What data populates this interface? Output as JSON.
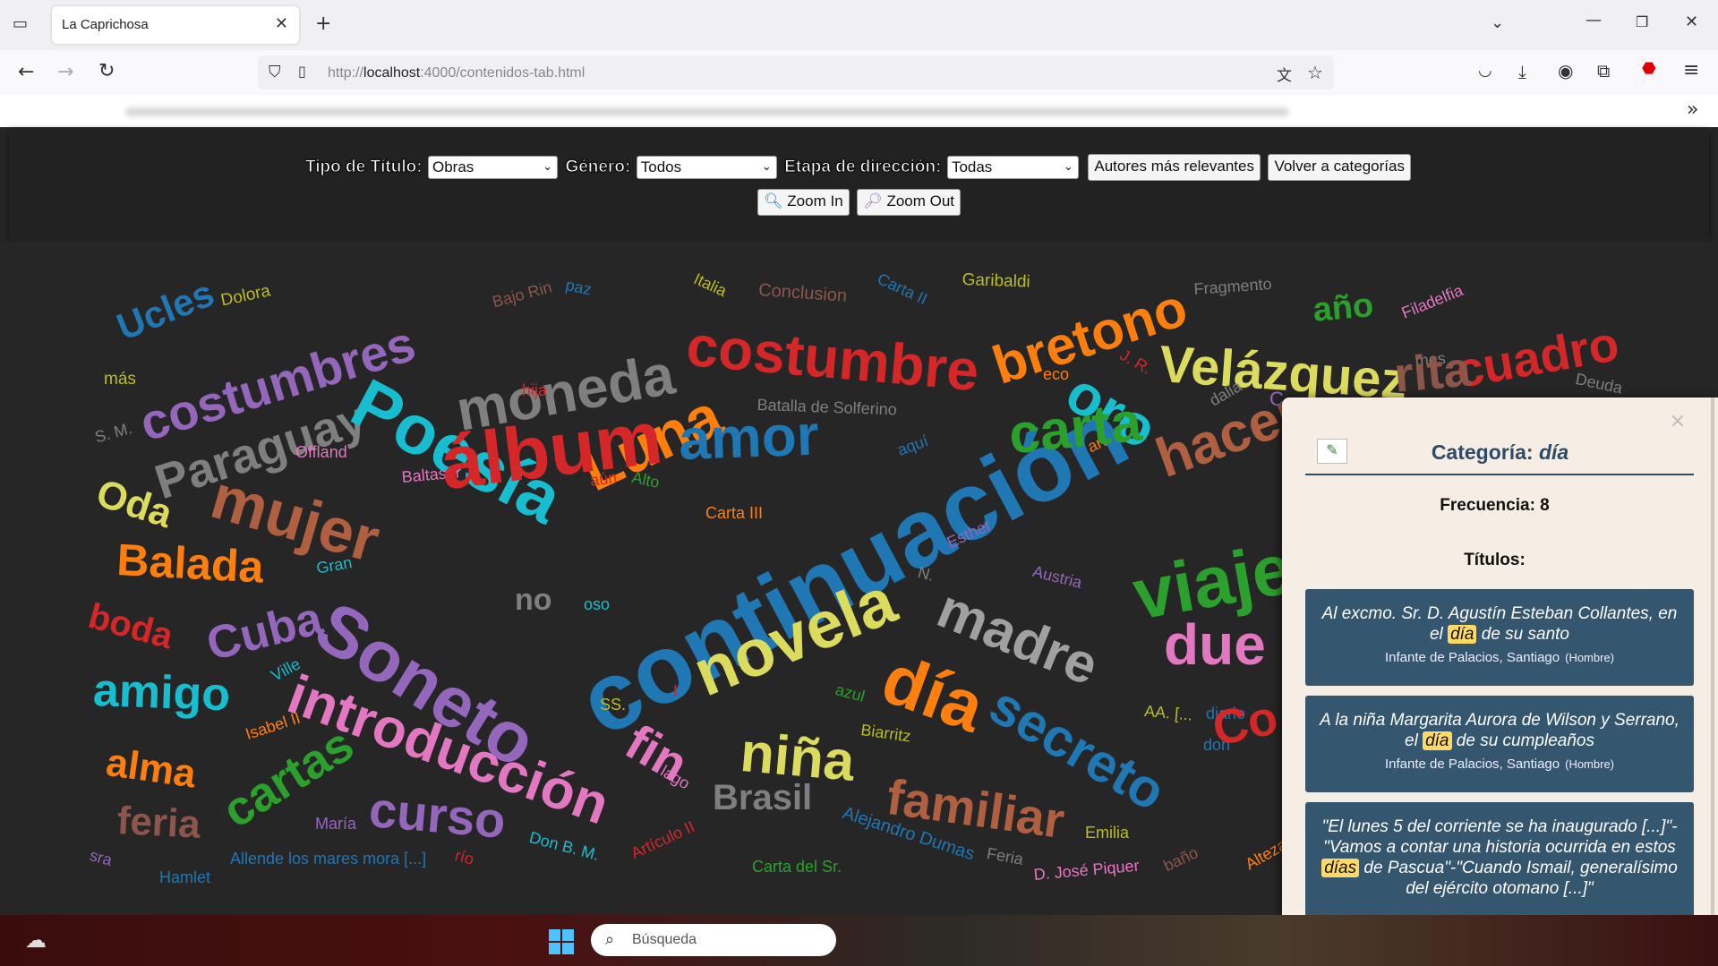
{
  "browser": {
    "tab_title": "La Caprichosa",
    "url_prefix": "http://",
    "url_host": "localhost",
    "url_rest": ":4000/contenidos-tab.html"
  },
  "controls": {
    "tipo_label": "Tipo de Título:",
    "tipo_value": "Obras",
    "genero_label": "Género:",
    "genero_value": "Todos",
    "etapa_label": "Etapa de dirección:",
    "etapa_value": "Todas",
    "autores_button": "Autores más relevantes",
    "volver_button": "Volver a categorías",
    "zoom_in": "Zoom In",
    "zoom_out": "Zoom Out"
  },
  "cloud_words": [
    {
      "t": "Ucles",
      "c": "#1f77b4"
    },
    {
      "t": "Dolora",
      "c": "#bcbd22"
    },
    {
      "t": "costumbres",
      "c": "#9467bd"
    },
    {
      "t": "Bajo Rin",
      "c": "#8c564b"
    },
    {
      "t": "paz",
      "c": "#1f77b4"
    },
    {
      "t": "moneda",
      "c": "#7f7f7f"
    },
    {
      "t": "Italia",
      "c": "#bcbd22"
    },
    {
      "t": "Conclusion",
      "c": "#8c564b"
    },
    {
      "t": "Carta II",
      "c": "#1f77b4"
    },
    {
      "t": "Garibaldi",
      "c": "#bcbd22"
    },
    {
      "t": "Fragmento",
      "c": "#7f7f7f"
    },
    {
      "t": "año",
      "c": "#2ca02c"
    },
    {
      "t": "Filadelfia",
      "c": "#e377c2"
    },
    {
      "t": "cuadro",
      "c": "#d62728"
    },
    {
      "t": "costumbre",
      "c": "#d62728"
    },
    {
      "t": "bretono",
      "c": "#ff7f0e"
    },
    {
      "t": "J. R.",
      "c": "#d62728"
    },
    {
      "t": "Velázquez",
      "c": "#dbdb5d"
    },
    {
      "t": "mes",
      "c": "#7f7f7f"
    },
    {
      "t": "más",
      "c": "#bcbd22"
    },
    {
      "t": "Paraguay",
      "c": "#7f7f7f"
    },
    {
      "t": "Poesía",
      "c": "#17becf"
    },
    {
      "t": "hija",
      "c": "#d62728"
    },
    {
      "t": "Luna",
      "c": "#ff7f0e"
    },
    {
      "t": "Batalla de Solferino",
      "c": "#7f7f7f"
    },
    {
      "t": "eco",
      "c": "#ff7f0e"
    },
    {
      "t": "oro",
      "c": "#17becf"
    },
    {
      "t": "dalia",
      "c": "#7f7f7f"
    },
    {
      "t": "rita",
      "c": "#8c564b"
    },
    {
      "t": "Deuda",
      "c": "#7f7f7f"
    },
    {
      "t": "S. M.",
      "c": "#7f7f7f"
    },
    {
      "t": "Offland",
      "c": "#e377c2"
    },
    {
      "t": "Baltasar",
      "c": "#e377c2"
    },
    {
      "t": "Alto",
      "c": "#2ca02c"
    },
    {
      "t": "aún",
      "c": "#d62728"
    },
    {
      "t": "amor",
      "c": "#1f77b4"
    },
    {
      "t": "aquí",
      "c": "#1f77b4"
    },
    {
      "t": "arte",
      "c": "#ff7f0e"
    },
    {
      "t": "hacer",
      "c": "#b06040"
    },
    {
      "t": "Oda",
      "c": "#dbdb5d"
    },
    {
      "t": "mujer",
      "c": "#b06040"
    },
    {
      "t": "Carta III",
      "c": "#ff7f0e"
    },
    {
      "t": "continuación",
      "c": "#1f77b4"
    },
    {
      "t": "carta",
      "c": "#2ca02c"
    },
    {
      "t": "álbum",
      "c": "#d62728"
    },
    {
      "t": "Balada",
      "c": "#ff7f0e"
    },
    {
      "t": "Gran",
      "c": "#17becf"
    },
    {
      "t": "Esther",
      "c": "#9467bd"
    },
    {
      "t": "Austria",
      "c": "#9467bd"
    },
    {
      "t": "viaje",
      "c": "#2ca02c"
    },
    {
      "t": "N.",
      "c": "#7f7f7f"
    },
    {
      "t": "no",
      "c": "#7f7f7f"
    },
    {
      "t": "oso",
      "c": "#17becf"
    },
    {
      "t": "boda",
      "c": "#d62728"
    },
    {
      "t": "Cuba",
      "c": "#9467bd"
    },
    {
      "t": "Soneto",
      "c": "#9467bd"
    },
    {
      "t": "novela",
      "c": "#dbdb5d"
    },
    {
      "t": "madre",
      "c": "#a0a0a0"
    },
    {
      "t": "due",
      "c": "#e377c2"
    },
    {
      "t": "Ville",
      "c": "#17becf"
    },
    {
      "t": "amigo",
      "c": "#17becf"
    },
    {
      "t": "introducción",
      "c": "#e377c2"
    },
    {
      "t": "día",
      "c": "#ff7f0e"
    },
    {
      "t": "I",
      "c": "#d62728"
    },
    {
      "t": "azul",
      "c": "#2ca02c"
    },
    {
      "t": "SS.",
      "c": "#bcbd22"
    },
    {
      "t": "AA. [...",
      "c": "#bcbd22"
    },
    {
      "t": "diario",
      "c": "#1f77b4"
    },
    {
      "t": "Isabel II",
      "c": "#ff7f0e"
    },
    {
      "t": "fin",
      "c": "#e377c2"
    },
    {
      "t": "Biarritz",
      "c": "#bcbd22"
    },
    {
      "t": "secreto",
      "c": "#1f77b4"
    },
    {
      "t": "alma",
      "c": "#ff7f0e"
    },
    {
      "t": "niña",
      "c": "#dbdb5d"
    },
    {
      "t": "don",
      "c": "#1f77b4"
    },
    {
      "t": "Co",
      "c": "#d62728"
    },
    {
      "t": "cartas",
      "c": "#2ca02c"
    },
    {
      "t": "curso",
      "c": "#9467bd"
    },
    {
      "t": "lago",
      "c": "#e377c2"
    },
    {
      "t": "familiar",
      "c": "#b06040"
    },
    {
      "t": "feria",
      "c": "#8c564b"
    },
    {
      "t": "María",
      "c": "#9467bd"
    },
    {
      "t": "Brasil",
      "c": "#7f7f7f"
    },
    {
      "t": "Alejandro Dumas",
      "c": "#1f77b4"
    },
    {
      "t": "Emilia",
      "c": "#bcbd22"
    },
    {
      "t": "Don B. M.",
      "c": "#17becf"
    },
    {
      "t": "Artículo II",
      "c": "#d62728"
    },
    {
      "t": "río",
      "c": "#d62728"
    },
    {
      "t": "Feria",
      "c": "#7f7f7f"
    },
    {
      "t": "baño",
      "c": "#8c564b"
    },
    {
      "t": "Alteza Re",
      "c": "#ff7f0e"
    },
    {
      "t": "sra",
      "c": "#9467bd"
    },
    {
      "t": "Hamlet",
      "c": "#1f77b4"
    },
    {
      "t": "Allende los mares mora [...]",
      "c": "#1f77b4"
    },
    {
      "t": "Carta del Sr.",
      "c": "#2ca02c"
    },
    {
      "t": "D. José Piquer",
      "c": "#e377c2"
    },
    {
      "t": "C",
      "c": "#9467bd"
    }
  ],
  "panel": {
    "title_prefix": "Categoría: ",
    "title_category": "día",
    "close": "×",
    "frecuencia": "Frecuencia: 8",
    "titulos_label": "Títulos:",
    "cards": [
      {
        "before": "Al excmo. Sr. D. Agustín Esteban Collantes, en el ",
        "hl": "día",
        "after": " de su santo",
        "author": "Infante de Palacios, Santiago",
        "gender": "(Hombre)"
      },
      {
        "before": "A la niña Margarita Aurora de Wilson y Serrano, el ",
        "hl": "día",
        "after": " de su cumpleaños",
        "author": "Infante de Palacios, Santiago",
        "gender": "(Hombre)"
      },
      {
        "before": "\"El lunes 5 del corriente se ha inaugurado [...]\"-\"Vamos a contar una historia ocurrida en estos ",
        "hl": "días",
        "after": " de Pascua\"-\"Cuando Ismail, generalísimo del ejército otomano [...]\"",
        "author": "",
        "gender": ""
      }
    ]
  },
  "taskbar": {
    "search_placeholder": "Búsqueda"
  }
}
